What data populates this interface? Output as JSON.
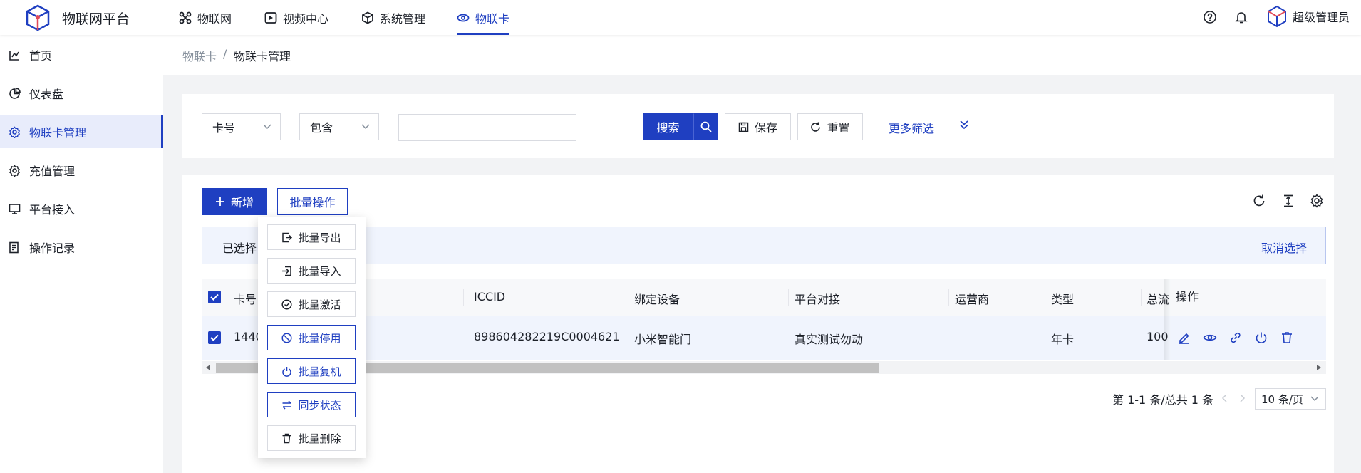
{
  "app": {
    "title": "物联网平台"
  },
  "nav": [
    {
      "label": "物联网",
      "icon": "iot-grid-icon"
    },
    {
      "label": "视频中心",
      "icon": "video-play-icon"
    },
    {
      "label": "系统管理",
      "icon": "system-cube-icon"
    },
    {
      "label": "物联卡",
      "icon": "iot-card-icon",
      "active": true
    }
  ],
  "header_right": {
    "help_icon": "question-circle-icon",
    "bell_icon": "bell-icon",
    "user_name": "超级管理员"
  },
  "sidebar": {
    "items": [
      {
        "label": "首页",
        "icon": "home-chart-icon"
      },
      {
        "label": "仪表盘",
        "icon": "pie-chart-icon"
      },
      {
        "label": "物联卡管理",
        "icon": "gear-icon",
        "active": true
      },
      {
        "label": "充值管理",
        "icon": "gear-icon"
      },
      {
        "label": "平台接入",
        "icon": "monitor-icon"
      },
      {
        "label": "操作记录",
        "icon": "log-icon"
      }
    ]
  },
  "breadcrumb": {
    "parent": "物联卡",
    "separator": "/",
    "current": "物联卡管理"
  },
  "filter": {
    "field_select": "卡号",
    "operator_select": "包含",
    "search_value": "",
    "search_label": "搜索",
    "save_label": "保存",
    "reset_label": "重置",
    "more_label": "更多筛选"
  },
  "toolbar": {
    "add_label": "新增",
    "batch_label": "批量操作"
  },
  "selection": {
    "selected_prefix": "已选择",
    "cancel_label": "取消选择"
  },
  "table": {
    "columns": [
      "卡号",
      "ICCID",
      "绑定设备",
      "平台对接",
      "运营商",
      "类型",
      "总流",
      "操作"
    ],
    "rows": [
      {
        "card_no": "1440",
        "iccid": "898604282219C0004621",
        "device": "小米智能门",
        "platform": "真实测试勿动",
        "carrier": "",
        "type": "年卡",
        "total": "100"
      }
    ]
  },
  "pagination": {
    "summary": "第 1-1 条/总共 1 条",
    "page_size": "10 条/页"
  },
  "batch_menu": [
    {
      "label": "批量导出",
      "icon": "export-icon",
      "style": "default"
    },
    {
      "label": "批量导入",
      "icon": "import-icon",
      "style": "default"
    },
    {
      "label": "批量激活",
      "icon": "check-circle-icon",
      "style": "default"
    },
    {
      "label": "批量停用",
      "icon": "stop-icon",
      "style": "blue"
    },
    {
      "label": "批量复机",
      "icon": "power-icon",
      "style": "blue"
    },
    {
      "label": "同步状态",
      "icon": "sync-arrows-icon",
      "style": "blue"
    },
    {
      "label": "批量删除",
      "icon": "trash-icon",
      "style": "default"
    }
  ],
  "colors": {
    "primary": "#1f3fc1",
    "selected_bg": "#f0f4fd",
    "text": "#1d2129",
    "muted": "#86909c"
  }
}
